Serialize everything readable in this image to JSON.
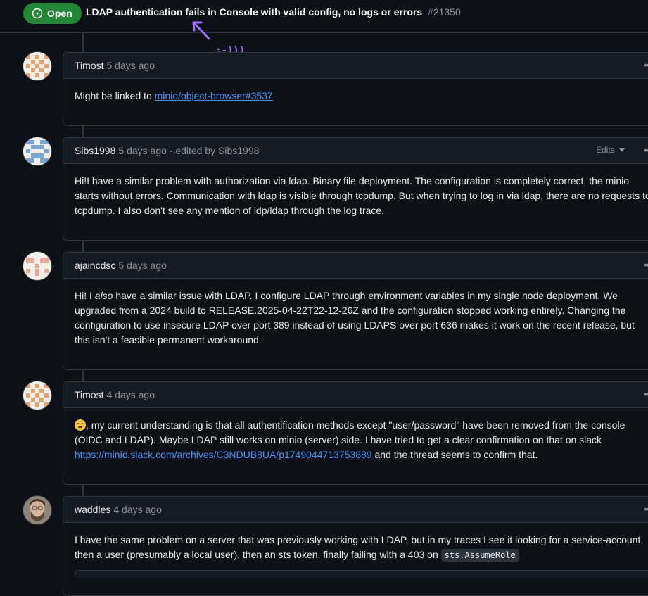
{
  "issue": {
    "state": "Open",
    "title": "LDAP authentication fails in Console with valid config, no logs or errors",
    "number": "#21350"
  },
  "annotation": {
    "smiley": ":-)))",
    "color": "#a371f7"
  },
  "colors": {
    "open_badge": "#238636",
    "link": "#4493f8",
    "background": "#0d1117",
    "border": "#30363d"
  },
  "comments": [
    {
      "author": "Timost",
      "time": "5 days ago",
      "body_prefix": "Might be linked to ",
      "link_text": "minio/object-browser#3537"
    },
    {
      "author": "Sibs1998",
      "time": "5 days ago · edited by Sibs1998",
      "edits_label": "Edits",
      "body": "Hi!I have a similar problem with authorization via ldap. Binary file deployment. The configuration is completely correct, the minio starts without errors. Communication with ldap is visible through tcpdump. But when trying to log in via ldap, there are no requests to tcpdump. I also don't see any mention of idp/ldap through the log trace."
    },
    {
      "author": "ajaincdsc",
      "time": "5 days ago",
      "body_prefix": "Hi! I ",
      "body_emphasis": "also",
      "body_suffix": " have a similar issue with LDAP. I configure LDAP through environment variables in my single node deployment. We upgraded from a 2024 build to RELEASE.2025-04-22T22-12-26Z and the configuration stopped working entirely. Changing the configuration to use insecure LDAP over port 389 instead of using LDAPS over port 636 makes it work on the recent release, but this isn't a feasible permanent workaround."
    },
    {
      "author": "Timost",
      "time": "4 days ago",
      "emoji": "thinking-face",
      "body_prefix": ", my current understanding is that all authentification methods except \"user/password\" have been removed from the console (OIDC and LDAP). Maybe LDAP still works on minio (server) side. I have tried to get a clear confirmation on that on slack ",
      "link_text": "https://minio.slack.com/archives/C3NDUB8UA/p1749044713753889",
      "body_suffix": " and the thread seems to confirm that."
    },
    {
      "author": "waddles",
      "time": "4 days ago",
      "body_prefix": "I have the same problem on a server that was previously working with LDAP, but in my traces I see it looking for a service-account, then a user (presumably a local user), then an sts token, finally failing with a 403 on ",
      "code": "sts.AssumeRole"
    }
  ],
  "menu_icon": "kebab-horizontal-icon"
}
